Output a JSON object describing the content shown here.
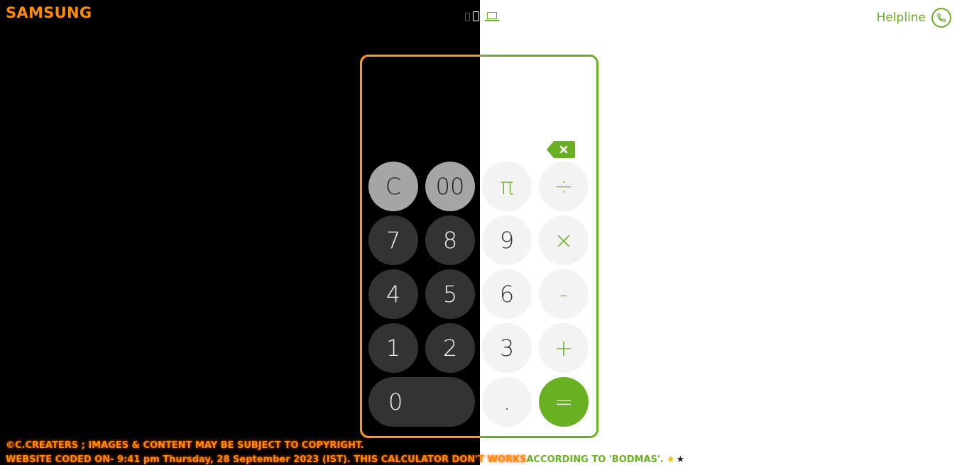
{
  "header": {
    "brand": "SAMSUNG",
    "helpline_label": "Helpline"
  },
  "device_icons": [
    "phone-small-icon",
    "phone-large-icon",
    "laptop-icon"
  ],
  "calculator": {
    "display_value": "",
    "keys": {
      "clear": "C",
      "double_zero": "00",
      "pi": "π",
      "divide": "÷",
      "seven": "7",
      "eight": "8",
      "nine": "9",
      "multiply": "×",
      "four": "4",
      "five": "5",
      "six": "6",
      "minus": "-",
      "one": "1",
      "two": "2",
      "three": "3",
      "plus": "+",
      "zero": "0",
      "dot": ".",
      "equals": "="
    }
  },
  "footer": {
    "line1": "©C.CREATERS ; IMAGES & CONTENT MAY BE SUBJECT TO COPYRIGHT.",
    "line2_a": "WEBSITE CODED ON- 9:41 pm Thursday, 28 September 2023 (IST). THIS CALCULATOR DON'T WORKS",
    "line2_b": " ACCORDING TO 'BODMAS'.",
    "star_yellow": "★",
    "star_dark": "★"
  },
  "colors": {
    "orange": "#ff8c00",
    "green": "#6ab023",
    "key_grey": "#a5a5a5",
    "key_dark": "#333333",
    "key_light": "#f3f3f3"
  }
}
